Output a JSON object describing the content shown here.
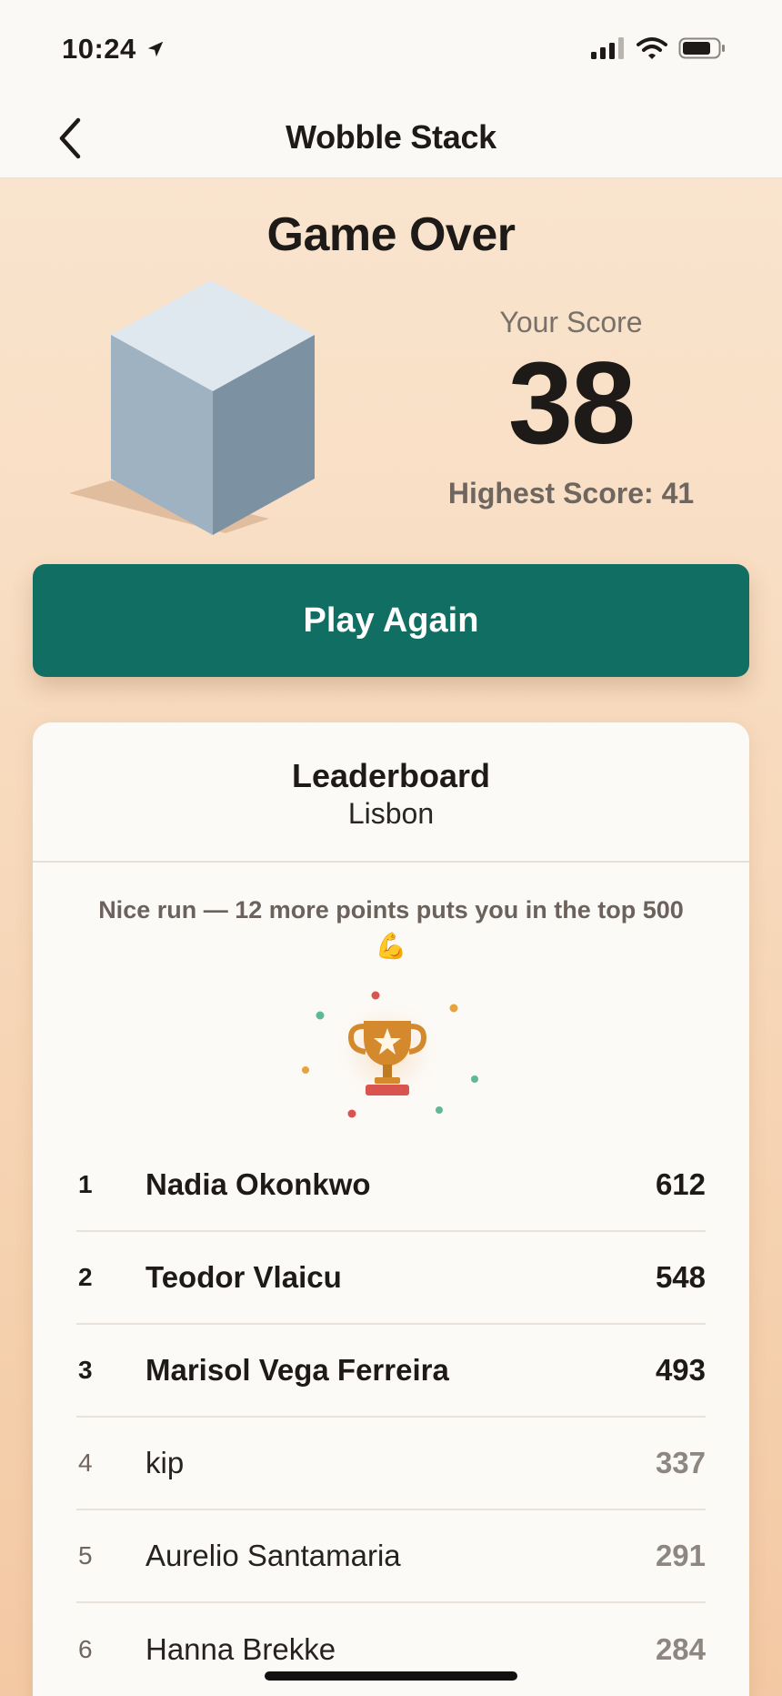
{
  "status_bar": {
    "time": "10:24"
  },
  "nav": {
    "title": "Wobble Stack"
  },
  "game_over": {
    "title": "Game Over",
    "score_label": "Your Score",
    "score": "38",
    "highest_score": "Highest Score: 41"
  },
  "actions": {
    "play_again": "Play Again"
  },
  "leaderboard": {
    "title": "Leaderboard",
    "city": "Lisbon",
    "message": "Nice run — 12 more points puts you in the top 500",
    "message_emoji": "💪",
    "rows": [
      {
        "rank": "1",
        "name": "Nadia Okonkwo",
        "score": "612"
      },
      {
        "rank": "2",
        "name": "Teodor Vlaicu",
        "score": "548"
      },
      {
        "rank": "3",
        "name": "Marisol Vega Ferreira",
        "score": "493"
      },
      {
        "rank": "4",
        "name": "kip",
        "score": "337"
      },
      {
        "rank": "5",
        "name": "Aurelio Santamaria",
        "score": "291"
      },
      {
        "rank": "6",
        "name": "Hanna Brekke",
        "score": "284"
      }
    ]
  },
  "colors": {
    "accent": "#116e62",
    "background_top": "#fae7d3",
    "background_bottom": "#f3c9a3",
    "trophy": "#d48a2c"
  }
}
